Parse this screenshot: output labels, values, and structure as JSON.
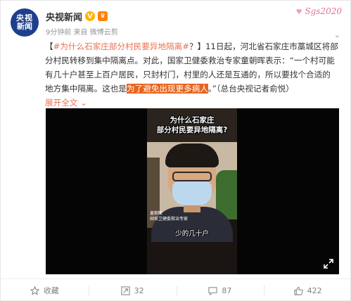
{
  "author": {
    "avatar_line1": "央视",
    "avatar_line2": "新闻",
    "name": "央视新闻",
    "verified_icon": "verified-v-icon",
    "member_icon": "member-crown-icon",
    "time": "9分钟前",
    "source": "来自 微博云剪"
  },
  "watermark": "Sgs2020",
  "post": {
    "hashtag": "#为什么石家庄部分村民要异地隔离#",
    "line1_rest": "？】11日起，河北省石家庄市藁城区将部",
    "line1_prefix": "【",
    "line2": "分村民转移到集中隔离点。对此，国家卫健委救治专家童朝晖表示：“一个村可能",
    "line3": "有几十户甚至上百户居民，只封村门，村里的人还是互通的，所以要找个合适的",
    "line4_a": "地方集中隔离。这也是",
    "line4_highlight": "为了避免出现更多病人",
    "line4_b": "。”（总台央视记者俞悦）",
    "expand_label": "展开全文",
    "expand_icon": "chevron-down-icon"
  },
  "video": {
    "caption_line1": "为什么石家庄",
    "caption_line2": "部分村民要异地隔离?",
    "nameplate_line1": "童朝晖",
    "nameplate_line2": "国家卫健委救治专家",
    "subtitle": "少的几十户",
    "fullscreen_icon": "fullscreen-icon"
  },
  "actions": {
    "favorite_label": "收藏",
    "repost_count": "32",
    "comment_count": "87",
    "like_count": "422"
  },
  "colors": {
    "accent": "#eb7350",
    "highlight": "#e8641c",
    "avatar_bg": "#1e3f8c"
  }
}
